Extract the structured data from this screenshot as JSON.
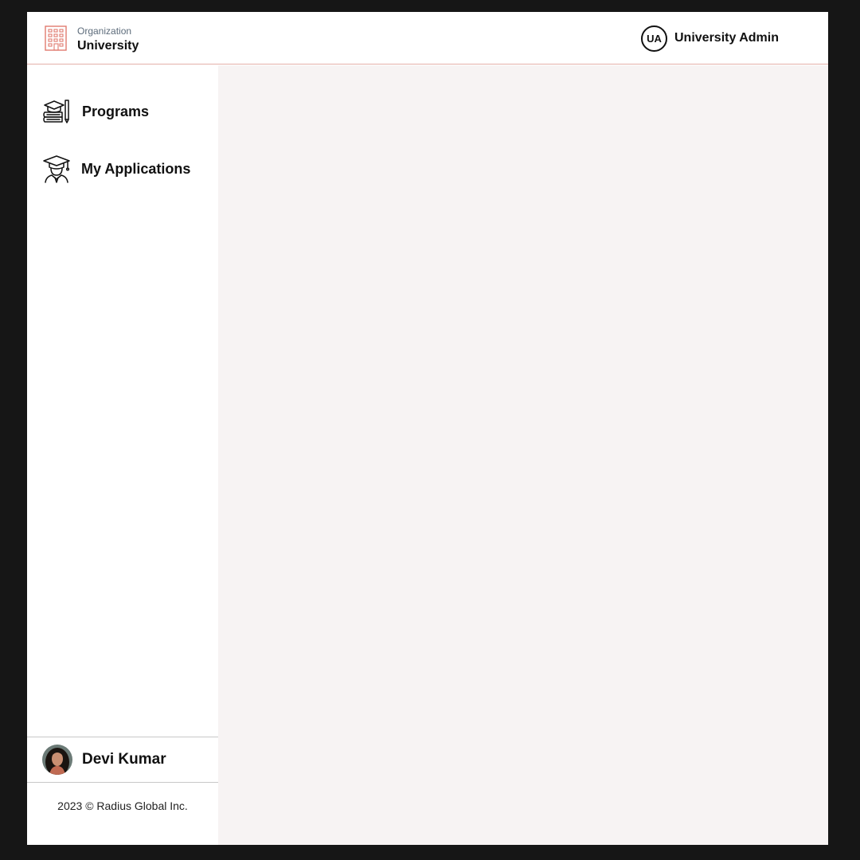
{
  "header": {
    "org_caption": "Organization",
    "org_name": "University",
    "org_icon": "building-icon",
    "admin_initials": "UA",
    "admin_name": "University Admin"
  },
  "sidebar": {
    "items": [
      {
        "label": "Programs",
        "icon": "books-icon"
      },
      {
        "label": "My Applications",
        "icon": "graduate-icon"
      }
    ],
    "user": {
      "name": "Devi Kumar"
    },
    "copyright": "2023 © Radius Global Inc."
  },
  "colors": {
    "accent": "#e4b0a9",
    "icon_accent": "#e07a6e",
    "main_background": "#f7f3f3",
    "frame_background": "#161616"
  }
}
